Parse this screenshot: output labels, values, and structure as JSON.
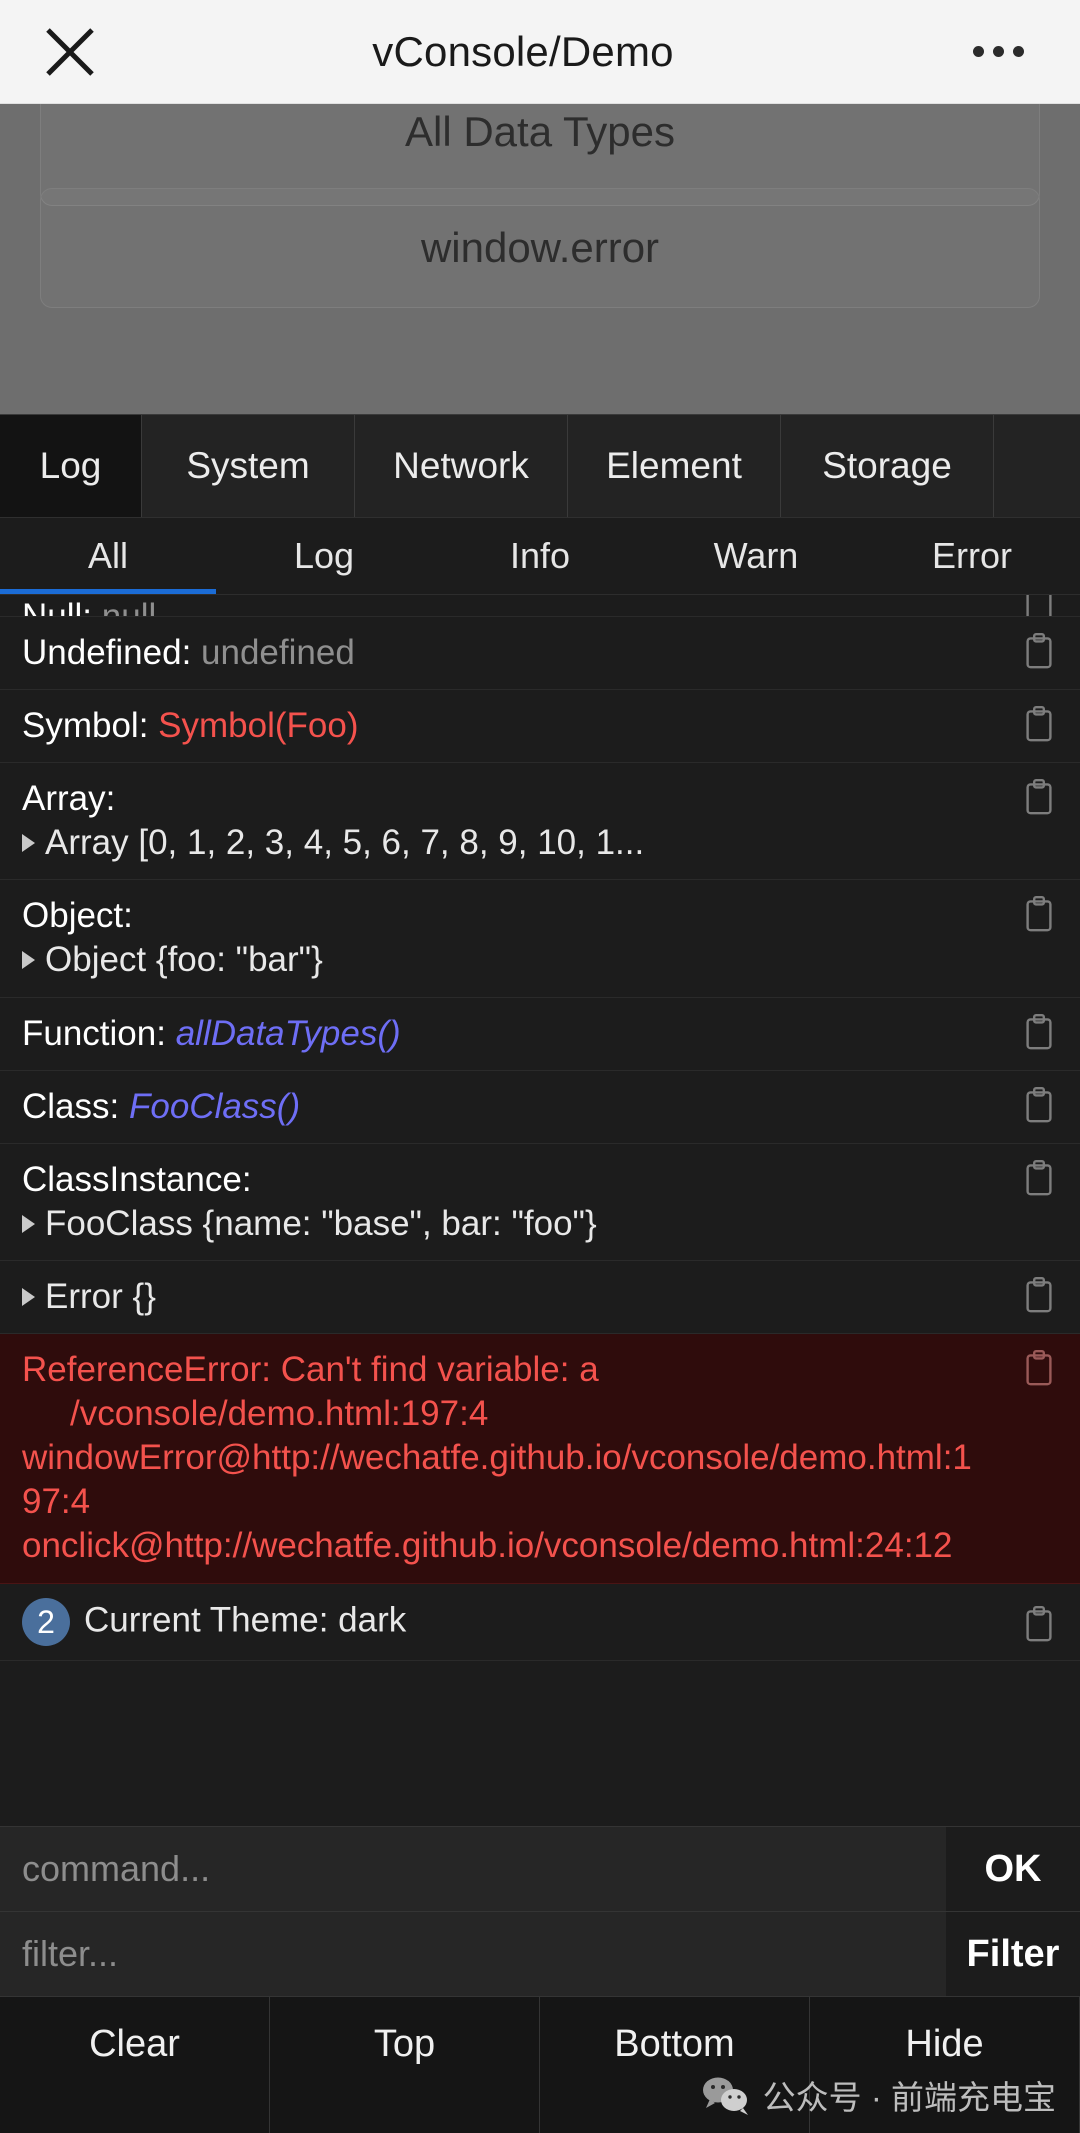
{
  "nav": {
    "close_icon": "close-icon",
    "title": "vConsole/Demo",
    "more_icon": "more-options-icon"
  },
  "page_behind": {
    "buttons": [
      {
        "label": "All Data Types"
      },
      {
        "label": "window.error"
      }
    ]
  },
  "vconsole": {
    "tabs": [
      {
        "label": "Log",
        "active": true
      },
      {
        "label": "System",
        "active": false
      },
      {
        "label": "Network",
        "active": false
      },
      {
        "label": "Element",
        "active": false
      },
      {
        "label": "Storage",
        "active": false
      }
    ],
    "subtabs": [
      {
        "label": "All",
        "active": true
      },
      {
        "label": "Log",
        "active": false
      },
      {
        "label": "Info",
        "active": false
      },
      {
        "label": "Warn",
        "active": false
      },
      {
        "label": "Error",
        "active": false
      }
    ],
    "accent_color": "#1b6cd6",
    "error_text_color": "#f4524d",
    "error_bg_color": "#2f0c0c",
    "badge_color": "#4a6f9c",
    "logs": [
      {
        "key": "Null:",
        "value": "null",
        "clipped": true
      },
      {
        "key": "Undefined:",
        "value": "undefined"
      },
      {
        "key": "Symbol:",
        "value": "Symbol(Foo)"
      },
      {
        "key": "Array:",
        "value": "Array [0, 1, 2, 3, 4, 5, 6, 7, 8, 9, 10, 1..."
      },
      {
        "key": "Object:",
        "value": "Object {foo: \"bar\"}"
      },
      {
        "key": "Function:",
        "value": "allDataTypes()"
      },
      {
        "key": "Class:",
        "value": "FooClass()"
      },
      {
        "key": "ClassInstance:",
        "value": "FooClass {name: \"base\", bar: \"foo\"}"
      },
      {
        "key": "",
        "value": "Error {}"
      }
    ],
    "error_entry": {
      "line1": "ReferenceError: Can't find variable: a",
      "line2": "/vconsole/demo.html:197:4",
      "line3": "windowError@http://wechatfe.github.io/vconsole/demo.html:197:4",
      "line4": "onclick@http://wechatfe.github.io/vconsole/demo.html:24:12"
    },
    "theme_entry": {
      "count": "2",
      "text": "Current Theme: dark"
    },
    "command": {
      "placeholder": "command...",
      "value": "",
      "button": "OK"
    },
    "filter": {
      "placeholder": "filter...",
      "value": "",
      "button": "Filter"
    },
    "toolbar": [
      {
        "label": "Clear"
      },
      {
        "label": "Top"
      },
      {
        "label": "Bottom"
      },
      {
        "label": "Hide"
      }
    ],
    "copy_icon_name": "copy-icon"
  },
  "watermark": {
    "icon": "wechat-icon",
    "text": "公众号 · 前端充电宝"
  }
}
